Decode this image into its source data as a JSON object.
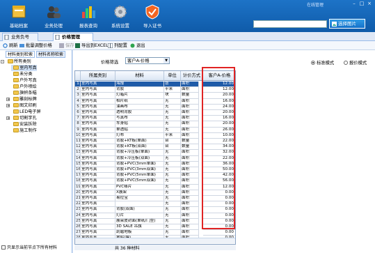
{
  "window": {
    "title": "在线管理",
    "controls": [
      "–",
      "□",
      "×"
    ]
  },
  "toolbar": {
    "buttons": [
      {
        "label": "基础档案",
        "icon": "archive-icon"
      },
      {
        "label": "业务处理",
        "icon": "users-icon"
      },
      {
        "label": "报表查询",
        "icon": "bar-chart-icon"
      },
      {
        "label": "系统设置",
        "icon": "gear-icon"
      },
      {
        "label": "导入证书",
        "icon": "shield-icon"
      }
    ],
    "search_placeholder": "",
    "search_button": "选择图片"
  },
  "tabs": [
    {
      "label": "业务负号"
    },
    {
      "label": "价格管理"
    }
  ],
  "subtoolbar": {
    "refresh": "刷新",
    "batch_adjust": "批量调整价格",
    "save": "保存",
    "export": "导出到EXCEL",
    "column_config": "列配置",
    "exit": "退出"
  },
  "left": {
    "tabs": [
      "材料类别检索",
      "材料名称检索"
    ],
    "tree": [
      {
        "label": "所有类别",
        "level": 0,
        "expander": "-"
      },
      {
        "label": "室内写真",
        "level": 1,
        "selected": true
      },
      {
        "label": "未分类",
        "level": 1
      },
      {
        "label": "户外写真",
        "level": 1
      },
      {
        "label": "户外喷绘",
        "level": 1
      },
      {
        "label": "旗帜条幅",
        "level": 1
      },
      {
        "label": "雕刻标牌",
        "level": 1,
        "expander": "+"
      },
      {
        "label": "图文印刷",
        "level": 1,
        "expander": "+"
      },
      {
        "label": "LED电子屏",
        "level": 1
      },
      {
        "label": "切割字孔",
        "level": 1,
        "expander": "+"
      },
      {
        "label": "安装拆除",
        "level": 1
      },
      {
        "label": "施工制作",
        "level": 1
      }
    ],
    "footer_checkbox": "只显示当前节点下所有材料"
  },
  "filter": {
    "label": "价格筛选",
    "value": "客户A-价格",
    "radio_standard": "标准模式",
    "radio_report": "报价模式"
  },
  "grid": {
    "headers": [
      "",
      "所属类别",
      "材料",
      "单位",
      "计价方式",
      "客户A-价格"
    ],
    "rows": [
      {
        "n": "1",
        "cat": "室内写真",
        "mat": "海报",
        "unit": "张",
        "mode": "面积",
        "price": "12.00"
      },
      {
        "n": "2",
        "cat": "室内写真",
        "mat": "背胶",
        "unit": "平米",
        "mode": "面积",
        "price": "12.00"
      },
      {
        "n": "3",
        "cat": "室内写真",
        "mat": "灯箱片",
        "unit": "块",
        "mode": "数量",
        "price": "20.00"
      },
      {
        "n": "4",
        "cat": "室内写真",
        "mat": "相片纸",
        "unit": "无",
        "mode": "面积",
        "price": "16.00"
      },
      {
        "n": "5",
        "cat": "室内写真",
        "mat": "油画布",
        "unit": "无",
        "mode": "面积",
        "price": "24.00"
      },
      {
        "n": "6",
        "cat": "室内写真",
        "mat": "透明背胶",
        "unit": "无",
        "mode": "面积",
        "price": "20.00"
      },
      {
        "n": "7",
        "cat": "室内写真",
        "mat": "写真布",
        "unit": "无",
        "mode": "面积",
        "price": "16.00"
      },
      {
        "n": "8",
        "cat": "室内写真",
        "mat": "车身贴",
        "unit": "无",
        "mode": "面积",
        "price": "20.00"
      },
      {
        "n": "9",
        "cat": "室内写真",
        "mat": "单透贴",
        "unit": "无",
        "mode": "面积",
        "price": "26.00"
      },
      {
        "n": "10",
        "cat": "室内写真",
        "mat": "灯布",
        "unit": "平米",
        "mode": "面积",
        "price": "10.00"
      },
      {
        "n": "11",
        "cat": "室内写真",
        "mat": "背胶+KT板(单面)",
        "unit": "台",
        "mode": "数量",
        "price": "22.00"
      },
      {
        "n": "12",
        "cat": "室内写真",
        "mat": "背胶+KT板(双面)",
        "unit": "台",
        "mode": "数量",
        "price": "34.00"
      },
      {
        "n": "13",
        "cat": "室内写真",
        "mat": "背胶+冷压板(单面)",
        "unit": "无",
        "mode": "面积",
        "price": "32.00"
      },
      {
        "n": "14",
        "cat": "室内写真",
        "mat": "背胶+冷压板(双面)",
        "unit": "无",
        "mode": "面积",
        "price": "22.00"
      },
      {
        "n": "15",
        "cat": "室内写真",
        "mat": "背胶+PVC(3mm单面)",
        "unit": "无",
        "mode": "面积",
        "price": "36.00"
      },
      {
        "n": "16",
        "cat": "室内写真",
        "mat": "背胶+PVC(3mm双面)",
        "unit": "无",
        "mode": "面积",
        "price": "50.00"
      },
      {
        "n": "17",
        "cat": "室内写真",
        "mat": "背胶+PVC(5mm单面)",
        "unit": "无",
        "mode": "面积",
        "price": "42.00"
      },
      {
        "n": "18",
        "cat": "室内写真",
        "mat": "背胶+PVC(5mm双面)",
        "unit": "无",
        "mode": "面积",
        "price": "56.00"
      },
      {
        "n": "19",
        "cat": "室内写真",
        "mat": "PVC裱片",
        "unit": "无",
        "mode": "面积",
        "price": "12.00"
      },
      {
        "n": "20",
        "cat": "室内写真",
        "mat": "X展架",
        "unit": "无",
        "mode": "面积",
        "price": "0.00"
      },
      {
        "n": "21",
        "cat": "室内写真",
        "mat": "易拉宝",
        "unit": "无",
        "mode": "面积",
        "price": "0.00"
      },
      {
        "n": "22",
        "cat": "室内写真",
        "mat": "",
        "unit": "无",
        "mode": "面积",
        "price": "0.00"
      },
      {
        "n": "23",
        "cat": "室内写真",
        "mat": "背胶(双面)",
        "unit": "无",
        "mode": "面积",
        "price": "0.00"
      },
      {
        "n": "24",
        "cat": "室内写真",
        "mat": "灯片",
        "unit": "无",
        "mode": "面积",
        "price": "0.00"
      },
      {
        "n": "25",
        "cat": "室内写真",
        "mat": "展架皮封面(单纸/门型)",
        "unit": "无",
        "mode": "面积",
        "price": "0.00"
      },
      {
        "n": "26",
        "cat": "室内写真",
        "mat": "3D SALE 吊旗",
        "unit": "无",
        "mode": "面积",
        "price": "0.00"
      },
      {
        "n": "27",
        "cat": "室内写真",
        "mat": "刮磨地板",
        "unit": "无",
        "mode": "面积",
        "price": "0.00"
      },
      {
        "n": "28",
        "cat": "室内写真",
        "mat": "地贴(膜)",
        "unit": "无",
        "mode": "面积",
        "price": "0.00"
      }
    ],
    "total": "共 36 种材料"
  }
}
